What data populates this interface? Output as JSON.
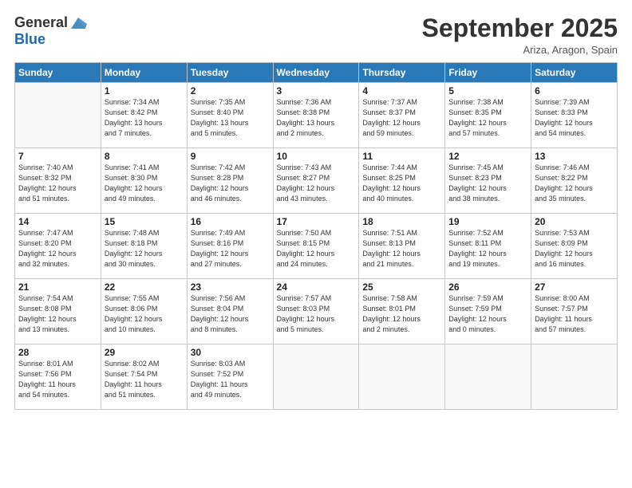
{
  "logo": {
    "general": "General",
    "blue": "Blue"
  },
  "title": "September 2025",
  "location": "Ariza, Aragon, Spain",
  "weekdays": [
    "Sunday",
    "Monday",
    "Tuesday",
    "Wednesday",
    "Thursday",
    "Friday",
    "Saturday"
  ],
  "weeks": [
    [
      {
        "day": "",
        "info": ""
      },
      {
        "day": "1",
        "info": "Sunrise: 7:34 AM\nSunset: 8:42 PM\nDaylight: 13 hours\nand 7 minutes."
      },
      {
        "day": "2",
        "info": "Sunrise: 7:35 AM\nSunset: 8:40 PM\nDaylight: 13 hours\nand 5 minutes."
      },
      {
        "day": "3",
        "info": "Sunrise: 7:36 AM\nSunset: 8:38 PM\nDaylight: 13 hours\nand 2 minutes."
      },
      {
        "day": "4",
        "info": "Sunrise: 7:37 AM\nSunset: 8:37 PM\nDaylight: 12 hours\nand 59 minutes."
      },
      {
        "day": "5",
        "info": "Sunrise: 7:38 AM\nSunset: 8:35 PM\nDaylight: 12 hours\nand 57 minutes."
      },
      {
        "day": "6",
        "info": "Sunrise: 7:39 AM\nSunset: 8:33 PM\nDaylight: 12 hours\nand 54 minutes."
      }
    ],
    [
      {
        "day": "7",
        "info": "Sunrise: 7:40 AM\nSunset: 8:32 PM\nDaylight: 12 hours\nand 51 minutes."
      },
      {
        "day": "8",
        "info": "Sunrise: 7:41 AM\nSunset: 8:30 PM\nDaylight: 12 hours\nand 49 minutes."
      },
      {
        "day": "9",
        "info": "Sunrise: 7:42 AM\nSunset: 8:28 PM\nDaylight: 12 hours\nand 46 minutes."
      },
      {
        "day": "10",
        "info": "Sunrise: 7:43 AM\nSunset: 8:27 PM\nDaylight: 12 hours\nand 43 minutes."
      },
      {
        "day": "11",
        "info": "Sunrise: 7:44 AM\nSunset: 8:25 PM\nDaylight: 12 hours\nand 40 minutes."
      },
      {
        "day": "12",
        "info": "Sunrise: 7:45 AM\nSunset: 8:23 PM\nDaylight: 12 hours\nand 38 minutes."
      },
      {
        "day": "13",
        "info": "Sunrise: 7:46 AM\nSunset: 8:22 PM\nDaylight: 12 hours\nand 35 minutes."
      }
    ],
    [
      {
        "day": "14",
        "info": "Sunrise: 7:47 AM\nSunset: 8:20 PM\nDaylight: 12 hours\nand 32 minutes."
      },
      {
        "day": "15",
        "info": "Sunrise: 7:48 AM\nSunset: 8:18 PM\nDaylight: 12 hours\nand 30 minutes."
      },
      {
        "day": "16",
        "info": "Sunrise: 7:49 AM\nSunset: 8:16 PM\nDaylight: 12 hours\nand 27 minutes."
      },
      {
        "day": "17",
        "info": "Sunrise: 7:50 AM\nSunset: 8:15 PM\nDaylight: 12 hours\nand 24 minutes."
      },
      {
        "day": "18",
        "info": "Sunrise: 7:51 AM\nSunset: 8:13 PM\nDaylight: 12 hours\nand 21 minutes."
      },
      {
        "day": "19",
        "info": "Sunrise: 7:52 AM\nSunset: 8:11 PM\nDaylight: 12 hours\nand 19 minutes."
      },
      {
        "day": "20",
        "info": "Sunrise: 7:53 AM\nSunset: 8:09 PM\nDaylight: 12 hours\nand 16 minutes."
      }
    ],
    [
      {
        "day": "21",
        "info": "Sunrise: 7:54 AM\nSunset: 8:08 PM\nDaylight: 12 hours\nand 13 minutes."
      },
      {
        "day": "22",
        "info": "Sunrise: 7:55 AM\nSunset: 8:06 PM\nDaylight: 12 hours\nand 10 minutes."
      },
      {
        "day": "23",
        "info": "Sunrise: 7:56 AM\nSunset: 8:04 PM\nDaylight: 12 hours\nand 8 minutes."
      },
      {
        "day": "24",
        "info": "Sunrise: 7:57 AM\nSunset: 8:03 PM\nDaylight: 12 hours\nand 5 minutes."
      },
      {
        "day": "25",
        "info": "Sunrise: 7:58 AM\nSunset: 8:01 PM\nDaylight: 12 hours\nand 2 minutes."
      },
      {
        "day": "26",
        "info": "Sunrise: 7:59 AM\nSunset: 7:59 PM\nDaylight: 12 hours\nand 0 minutes."
      },
      {
        "day": "27",
        "info": "Sunrise: 8:00 AM\nSunset: 7:57 PM\nDaylight: 11 hours\nand 57 minutes."
      }
    ],
    [
      {
        "day": "28",
        "info": "Sunrise: 8:01 AM\nSunset: 7:56 PM\nDaylight: 11 hours\nand 54 minutes."
      },
      {
        "day": "29",
        "info": "Sunrise: 8:02 AM\nSunset: 7:54 PM\nDaylight: 11 hours\nand 51 minutes."
      },
      {
        "day": "30",
        "info": "Sunrise: 8:03 AM\nSunset: 7:52 PM\nDaylight: 11 hours\nand 49 minutes."
      },
      {
        "day": "",
        "info": ""
      },
      {
        "day": "",
        "info": ""
      },
      {
        "day": "",
        "info": ""
      },
      {
        "day": "",
        "info": ""
      }
    ]
  ]
}
